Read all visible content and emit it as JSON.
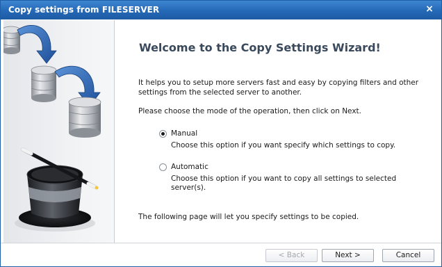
{
  "window": {
    "title": "Copy settings from FILESERVER",
    "close_glyph": "×",
    "close_icon": "close-icon"
  },
  "sidebar": {
    "illustration": "database-copy-magic-hat-illustration",
    "icons": [
      "database-icon",
      "database-icon",
      "database-icon",
      "magic-hat-icon",
      "arrow-icon"
    ],
    "arrow_color": "#2563b5"
  },
  "content": {
    "heading": "Welcome to the Copy Settings Wizard!",
    "intro": "It helps you to setup more servers fast and easy by copying filters and other settings from the selected server to another.",
    "choose_text": "Please choose the mode of the operation, then click on Next.",
    "options": [
      {
        "label": "Manual",
        "description": "Choose this option if you want specify which settings to copy.",
        "selected": true
      },
      {
        "label": "Automatic",
        "description": "Choose this option if you want to copy all settings to selected server(s).",
        "selected": false
      }
    ],
    "footer": "The following page will let you specify settings to be copied."
  },
  "buttons": {
    "back": "< Back",
    "next": "Next >",
    "cancel": "Cancel"
  },
  "colors": {
    "titlebar": "#2468b6",
    "heading": "#3a4a5c"
  }
}
